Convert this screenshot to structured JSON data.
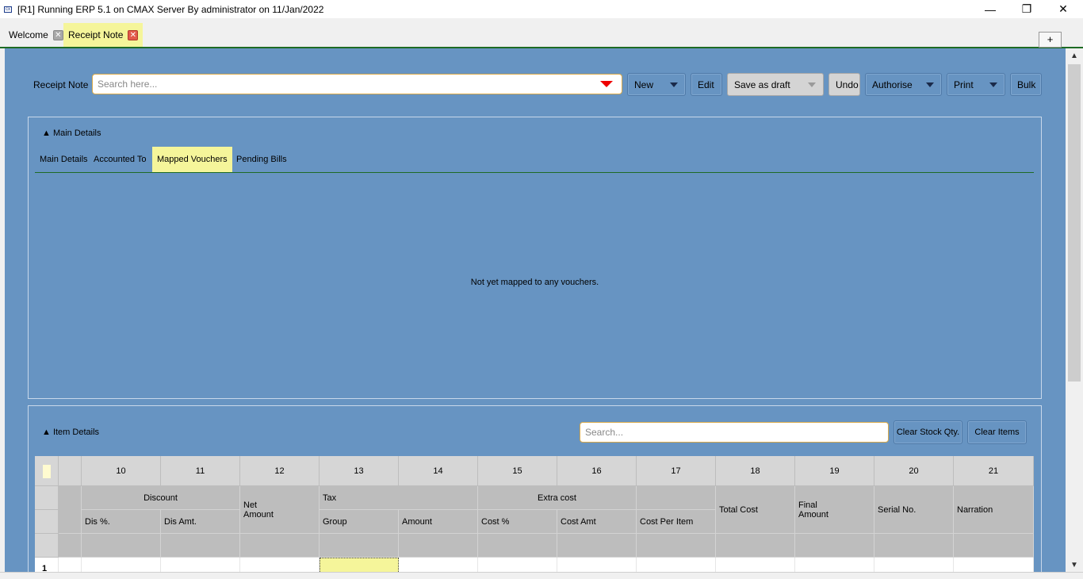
{
  "window": {
    "title": "[R1] Running ERP 5.1 on CMAX Server By administrator on 11/Jan/2022",
    "min": "—",
    "max": "❐",
    "close": "✕"
  },
  "tabs": [
    {
      "label": "Welcome"
    },
    {
      "label": "Receipt Note"
    }
  ],
  "tab_close": "✕",
  "tab_add": "+",
  "toolbar": {
    "label": "Receipt Note",
    "search_placeholder": "Search here...",
    "new": "New",
    "edit": "Edit",
    "save_draft": "Save as draft",
    "undo": "Undo",
    "authorise": "Authorise",
    "print": "Print",
    "bulk": "Bulk"
  },
  "main_details": {
    "title": "▲ Main Details",
    "tabs": [
      "Main Details",
      "Accounted To",
      "Mapped Vouchers",
      "Pending Bills"
    ],
    "empty_message": "Not yet mapped to any vouchers."
  },
  "item_details": {
    "title": "▲ Item Details",
    "search_placeholder": "Search...",
    "clear_stock": "Clear Stock Qty.",
    "clear_items": "Clear Items",
    "column_numbers": [
      "10",
      "11",
      "12",
      "13",
      "14",
      "15",
      "16",
      "17",
      "18",
      "19",
      "20",
      "21"
    ],
    "group_headers": {
      "discount": "Discount",
      "net_amount": "Net\nAmount",
      "tax": "Tax",
      "extra_cost": "Extra cost",
      "total_cost": "Total Cost",
      "final_amount": "Final\nAmount",
      "serial_no": "Serial No.",
      "narration": "Narration"
    },
    "sub_headers": {
      "dis_pct": "Dis %.",
      "dis_amt": "Dis Amt.",
      "group": "Group",
      "amount": "Amount",
      "cost_pct": "Cost %",
      "cost_amt": "Cost Amt",
      "cost_per_item": "Cost Per Item"
    },
    "row_number": "1"
  }
}
